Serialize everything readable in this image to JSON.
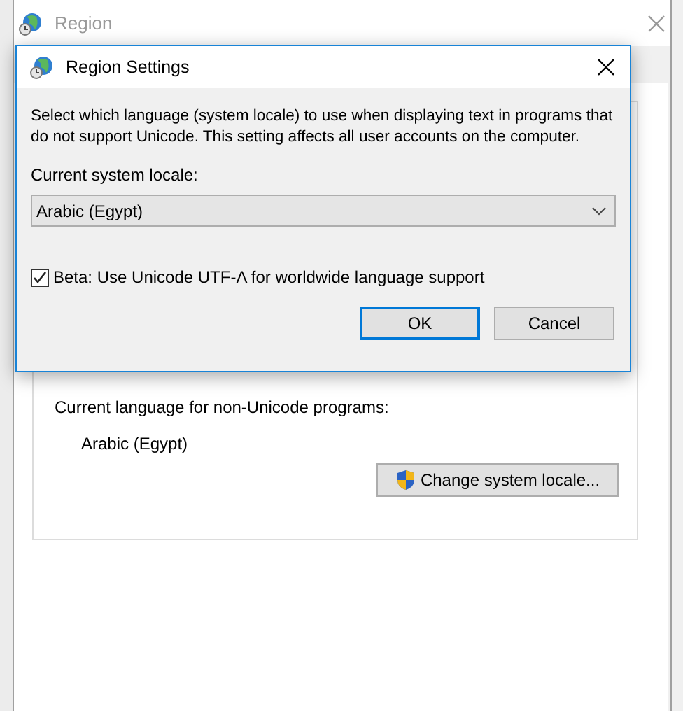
{
  "window": {
    "title": "Region",
    "active": false
  },
  "background_panel": {
    "current_language_label": "Current language for non-Unicode programs:",
    "current_language": "Arabic (Egypt)",
    "change_button": "Change system locale..."
  },
  "dialog": {
    "title": "Region Settings",
    "description": "Select which language (system locale) to use when displaying text in programs that do not support Unicode. This setting affects all user accounts on the computer.",
    "locale_label": "Current system locale:",
    "locale_value": "Arabic (Egypt)",
    "beta_option": {
      "label": "Beta: Use Unicode UTF-Λ for worldwide language support",
      "checked": true
    },
    "buttons": [
      {
        "label": "OK",
        "default": true
      },
      {
        "label": "Cancel",
        "default": false
      }
    ]
  }
}
